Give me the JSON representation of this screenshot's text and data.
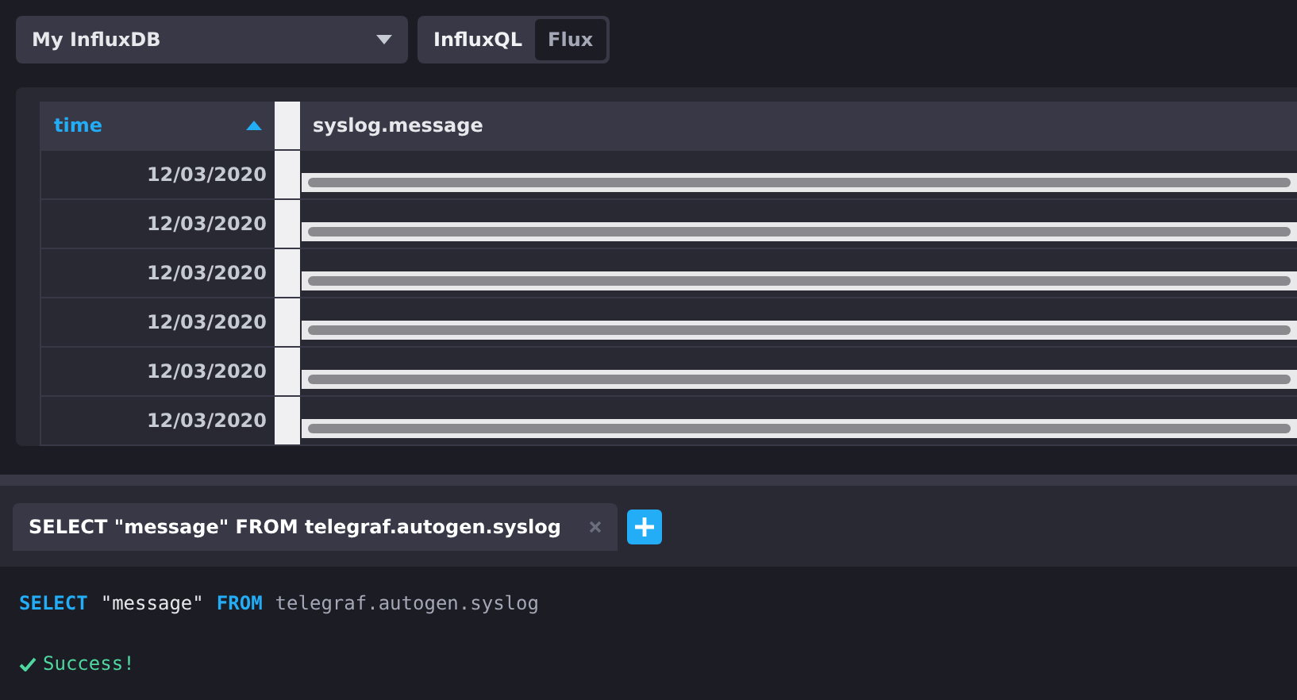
{
  "source_dropdown": {
    "value": "My InfluxDB"
  },
  "language_toggle": [
    {
      "label": "InfluxQL",
      "selected": true
    },
    {
      "label": "Flux",
      "selected": false
    }
  ],
  "table": {
    "columns": [
      {
        "label": "time",
        "sorted": true
      },
      {
        "label": "syslog.message",
        "sorted": false
      }
    ],
    "rows": [
      {
        "time": "12/03/2020"
      },
      {
        "time": "12/03/2020"
      },
      {
        "time": "12/03/2020"
      },
      {
        "time": "12/03/2020"
      },
      {
        "time": "12/03/2020"
      },
      {
        "time": "12/03/2020"
      }
    ]
  },
  "query_tabs": [
    {
      "label": "SELECT \"message\" FROM telegraf.autogen.syslog",
      "selected": true
    }
  ],
  "query": [
    {
      "kind": "keyword",
      "text": "SELECT"
    },
    {
      "kind": "string",
      "text": "\"message\""
    },
    {
      "kind": "keyword",
      "text": "FROM"
    },
    {
      "kind": "identifier",
      "text": "telegraf.autogen.syslog"
    }
  ],
  "status": {
    "kind": "success",
    "text": "Success!"
  }
}
